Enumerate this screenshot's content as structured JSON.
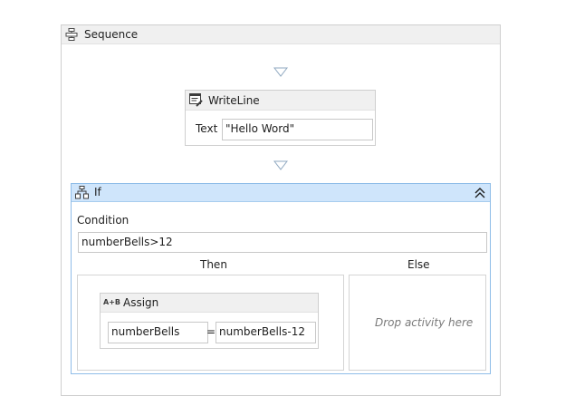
{
  "sequence": {
    "title": "Sequence",
    "icon": "sequence-icon"
  },
  "writeline": {
    "title": "WriteLine",
    "icon": "writeline-icon",
    "text_label": "Text",
    "text_value": "\"Hello Word\""
  },
  "if_activity": {
    "title": "If",
    "icon": "if-icon",
    "collapse_icon": "double-chevron-up-icon",
    "condition_label": "Condition",
    "condition_value": "numberBells>12",
    "then_label": "Then",
    "else_label": "Else",
    "else_placeholder": "Drop activity here"
  },
  "assign": {
    "title": "Assign",
    "icon": "assign-icon",
    "icon_text": "A+B",
    "to_value": "numberBells",
    "equals": "=",
    "value": "numberBells-12"
  },
  "colors": {
    "header_gray": "#f0f0f0",
    "border_gray": "#cfcfcf",
    "if_header_blue": "#cfe5fb",
    "if_border_blue": "#8fbde8",
    "drop_arrow": "#8fa8c0"
  }
}
